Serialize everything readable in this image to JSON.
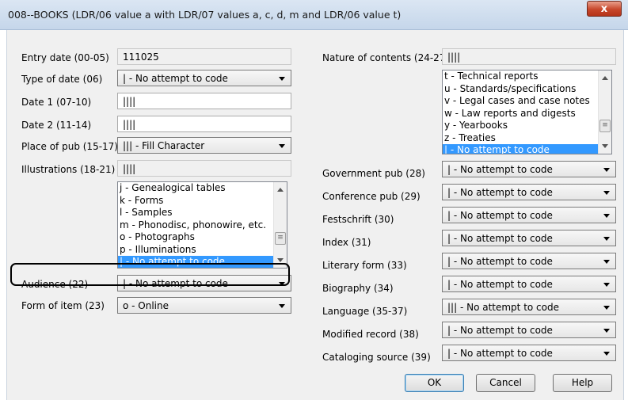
{
  "window": {
    "title": "008--BOOKS (LDR/06 value a with LDR/07 values a, c, d, m and LDR/06 value t)",
    "close_label": "x"
  },
  "left": {
    "entry_date": {
      "label": "Entry date (00-05)",
      "value": "111025"
    },
    "type_of_date": {
      "label": "Type of date (06)",
      "value": "| - No attempt to code"
    },
    "date1": {
      "label": "Date 1 (07-10)",
      "value": "||||"
    },
    "date2": {
      "label": "Date 2 (11-14)",
      "value": "||||"
    },
    "place_of_pub": {
      "label": "Place of pub (15-17)",
      "value": "||| - Fill Character"
    },
    "illustrations": {
      "label": "Illustrations (18-21)",
      "value": "||||",
      "list": [
        "j - Genealogical tables",
        "k - Forms",
        "l - Samples",
        "m - Phonodisc, phonowire, etc.",
        "o - Photographs",
        "p - Illuminations",
        "| - No attempt to code"
      ]
    },
    "audience": {
      "label": "Audience (22)",
      "value": "| - No attempt to code"
    },
    "form_of_item": {
      "label": "Form of item (23)",
      "value": "o - Online"
    }
  },
  "right": {
    "nature_of_contents": {
      "label": "Nature of contents (24-27)",
      "value": "||||",
      "list": [
        "t - Technical reports",
        "u - Standards/specifications",
        "v - Legal cases and case notes",
        "w - Law reports and digests",
        "y - Yearbooks",
        "z - Treaties",
        "| - No attempt to code"
      ]
    },
    "government_pub": {
      "label": "Government pub (28)",
      "value": "| - No attempt to code"
    },
    "conference_pub": {
      "label": "Conference pub (29)",
      "value": "| - No attempt to code"
    },
    "festschrift": {
      "label": "Festschrift (30)",
      "value": "| - No attempt to code"
    },
    "index": {
      "label": "Index (31)",
      "value": "| - No attempt to code"
    },
    "literary_form": {
      "label": "Literary form (33)",
      "value": "| - No attempt to code"
    },
    "biography": {
      "label": "Biography (34)",
      "value": "| - No attempt to code"
    },
    "language": {
      "label": "Language (35-37)",
      "value": "||| - No attempt to code"
    },
    "modified_record": {
      "label": "Modified record (38)",
      "value": "| - No attempt to code"
    },
    "cataloging_source": {
      "label": "Cataloging source (39)",
      "value": "| - No attempt to code"
    }
  },
  "buttons": {
    "ok": "OK",
    "cancel": "Cancel",
    "help": "Help"
  },
  "scroll_thumb_glyph": "≡"
}
